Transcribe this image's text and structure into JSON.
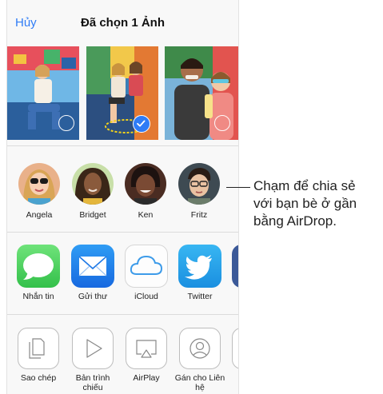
{
  "header": {
    "cancel_label": "Hủy",
    "title": "Đã chọn 1 Ảnh"
  },
  "photos": [
    {
      "id": "photo-1",
      "selected": false
    },
    {
      "id": "photo-2",
      "selected": true
    },
    {
      "id": "photo-3",
      "selected": false
    }
  ],
  "airdrop": {
    "contacts": [
      {
        "name": "Angela"
      },
      {
        "name": "Bridget"
      },
      {
        "name": "Ken"
      },
      {
        "name": "Fritz"
      }
    ]
  },
  "apps": [
    {
      "label": "Nhắn tin",
      "icon": "messages-icon"
    },
    {
      "label": "Gửi thư",
      "icon": "mail-icon"
    },
    {
      "label": "iCloud",
      "icon": "icloud-icon"
    },
    {
      "label": "Twitter",
      "icon": "twitter-icon"
    }
  ],
  "actions": [
    {
      "label": "Sao chép",
      "icon": "copy-icon"
    },
    {
      "label": "Bản trình chiếu",
      "icon": "slideshow-icon"
    },
    {
      "label": "AirPlay",
      "icon": "airplay-icon"
    },
    {
      "label": "Gán cho Liên hệ",
      "icon": "assign-contact-icon"
    }
  ],
  "callout": {
    "lines": [
      "Chạm để chia sẻ",
      "với bạn bè ở gần",
      "bằng AirDrop."
    ]
  },
  "colors": {
    "accent": "#2f7cf6",
    "messages": "#4cd964",
    "twitter": "#1da1f2"
  }
}
